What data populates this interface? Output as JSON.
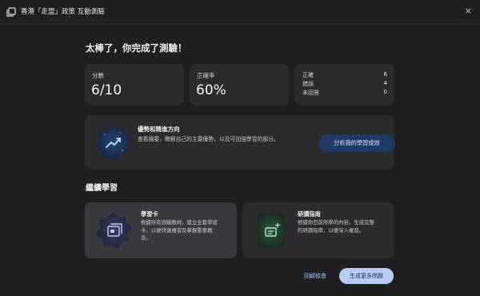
{
  "window": {
    "title": "香港「走盟」政策 互動測驗",
    "close_glyph": "×"
  },
  "result": {
    "heading": "太棒了，你完成了測驗！",
    "score_label": "分數",
    "score_value": "6/10",
    "accuracy_label": "正確率",
    "accuracy_value": "60%",
    "breakdown": [
      {
        "label": "正確",
        "value": "6"
      },
      {
        "label": "錯誤",
        "value": "4"
      },
      {
        "label": "未回答",
        "value": "0"
      }
    ]
  },
  "insight": {
    "title": "優勢和精進方向",
    "description": "查看摘要，瞭解自己的主要優勢，以及可加強學習的部分。",
    "button_label": "分析我的學習成效",
    "icon": "trend-up-icon"
  },
  "continue": {
    "title": "繼續學習",
    "cards": [
      {
        "title": "學習卡",
        "description": [
          "根據所有測驗教材，建立全套學習",
          "卡，以便快速複習及掌握重要概",
          "念。"
        ],
        "icon": "flashcard-icon"
      },
      {
        "title": "研讀指南",
        "description": [
          "根據你目前所學的內容，生成完整",
          "的研讀指南，以便深入複習。"
        ],
        "icon": "study-guide-icon"
      }
    ]
  },
  "footer": {
    "review_label": "回顧檢查",
    "generate_label": "生成更多問題"
  },
  "colors": {
    "background": "#1f1f22",
    "card": "#2b2b2e",
    "accent_button": "#1f3a64",
    "primary_button": "#b9cdfa"
  }
}
